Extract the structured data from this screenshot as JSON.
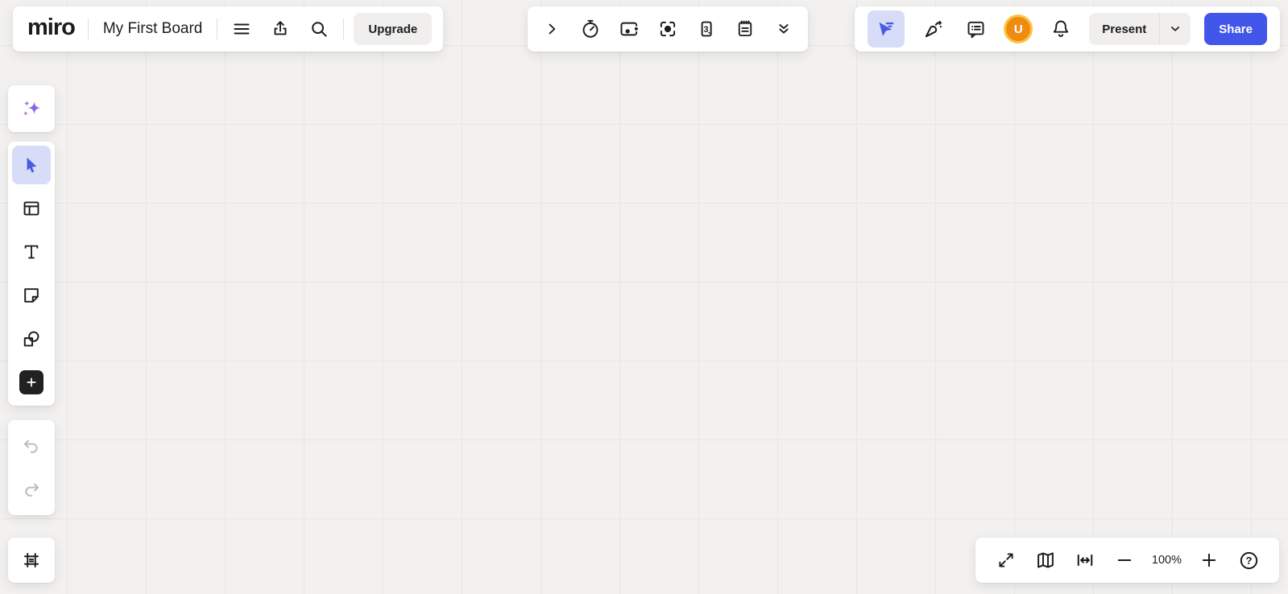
{
  "app": {
    "logo_text": "miro"
  },
  "header": {
    "board_title": "My First Board",
    "upgrade_label": "Upgrade",
    "icons": [
      "menu-icon",
      "export-icon",
      "search-icon"
    ]
  },
  "collab_toolbar": {
    "estimation_value": "3",
    "icons": [
      "collapse-right-icon",
      "timer-icon",
      "talktrack-icon",
      "spotlight-icon",
      "estimation-card-icon",
      "notes-icon",
      "more-tools-icon"
    ]
  },
  "presence": {
    "avatar_initial": "U",
    "present_label": "Present",
    "share_label": "Share",
    "icons": [
      "collaborator-cursors-icon",
      "reactions-icon",
      "comments-icon",
      "notifications-bell-icon",
      "chevron-down-icon"
    ]
  },
  "sidebar": {
    "icons": [
      "ai-sparkles-icon",
      "select-cursor-icon",
      "templates-icon",
      "text-icon",
      "sticky-note-icon",
      "shapes-icon",
      "add-tool-icon"
    ],
    "active_tool": "select",
    "history_icons": [
      "undo-icon",
      "redo-icon"
    ],
    "frame_icon": "frame-icon"
  },
  "zoom_controls": {
    "zoom_level": "100%",
    "help_glyph": "?",
    "icons": [
      "expand-icon",
      "minimap-icon",
      "fit-to-screen-icon",
      "zoom-out-icon",
      "zoom-in-icon",
      "help-icon"
    ]
  },
  "colors": {
    "accent_blue": "#4257e9",
    "active_tool_bg": "#d7dcf8",
    "tool_arrow_blue": "#4a5be0",
    "avatar_orange": "#ef8b13",
    "avatar_ring": "#fdc43f",
    "canvas_bg": "#f2f1ef",
    "grid_line": "#e6e6e4"
  }
}
